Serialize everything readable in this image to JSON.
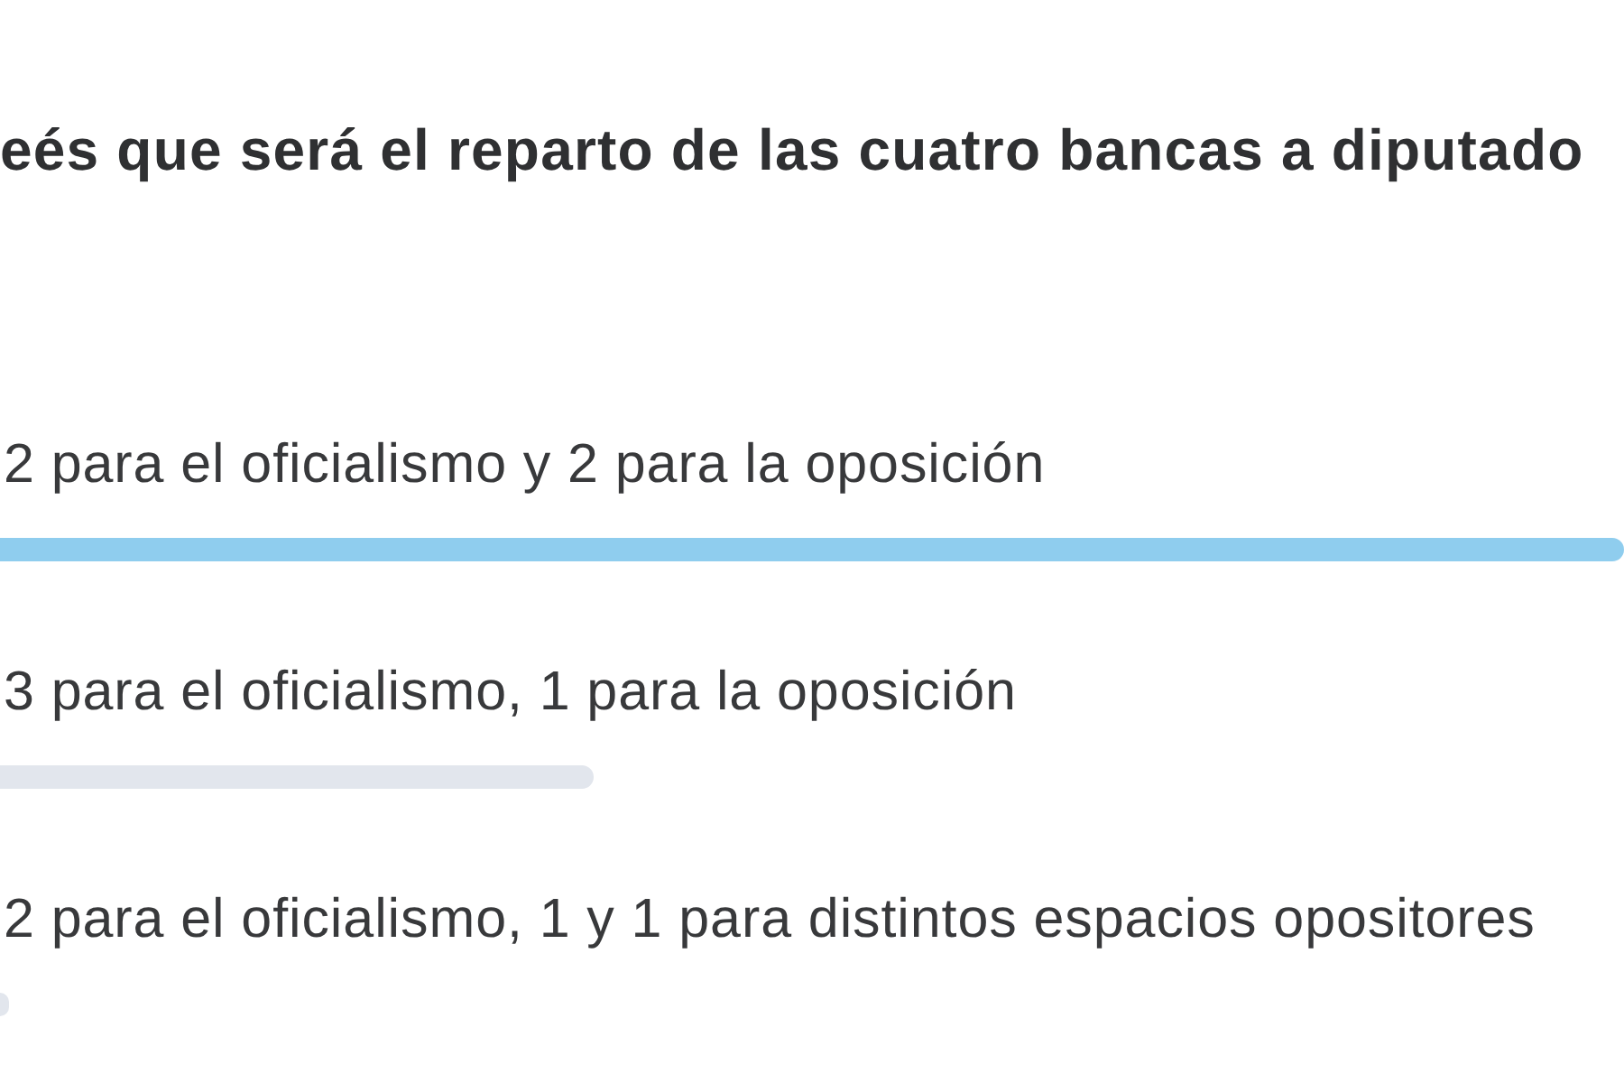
{
  "question": "eés que será el reparto de las cuatro bancas a diputado",
  "options": [
    {
      "label": "2 para el oficialismo y 2 para la oposición",
      "level": 1,
      "color": "#8fcdee"
    },
    {
      "label": "3 para el oficialismo, 1 para la oposición",
      "level": 0.365,
      "color": "#e2e6ed"
    },
    {
      "label": "2 para el oficialismo, 1 y 1 para distintos espacios opositores",
      "level": 0.005,
      "color": "#e2e6ed"
    }
  ]
}
